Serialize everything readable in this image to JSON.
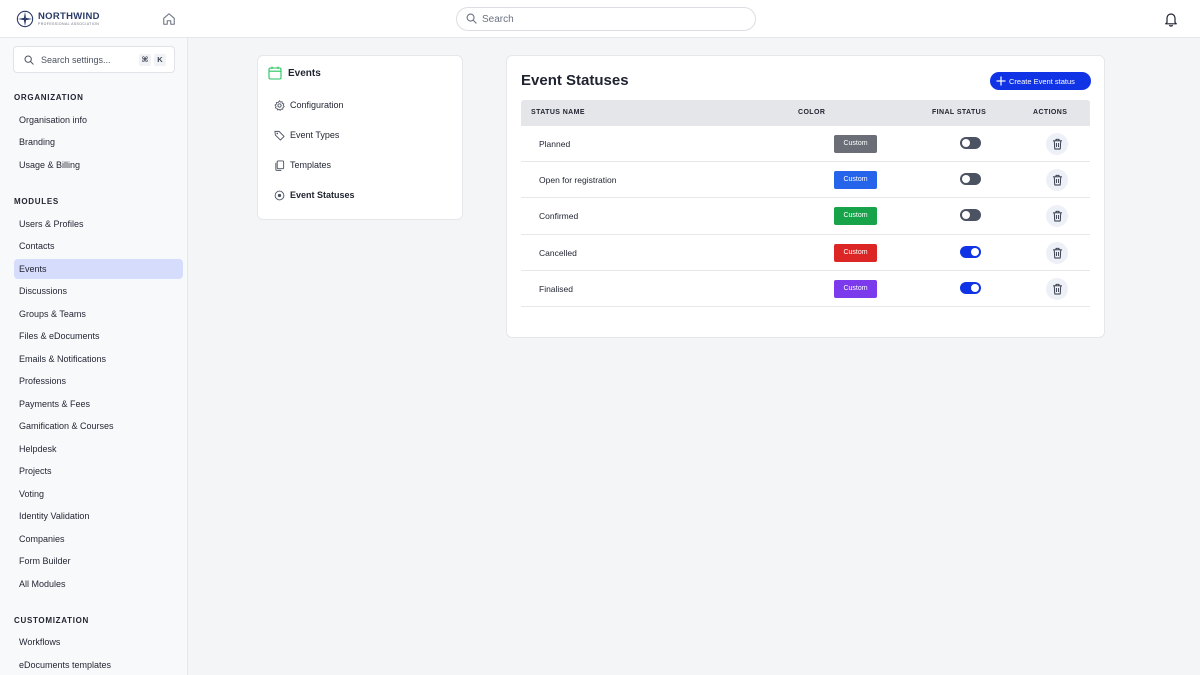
{
  "header": {
    "logo_name": "NORTHWIND",
    "logo_sub": "PROFESSIONAL ASSOCIATION",
    "search_placeholder": "Search"
  },
  "sidebar": {
    "search_placeholder": "Search settings...",
    "shortcut_mod": "⌘",
    "shortcut_key": "K",
    "sections": [
      {
        "title": "ORGANIZATION",
        "items": [
          "Organisation info",
          "Branding",
          "Usage & Billing"
        ]
      },
      {
        "title": "MODULES",
        "items": [
          "Users & Profiles",
          "Contacts",
          "Events",
          "Discussions",
          "Groups & Teams",
          "Files & eDocuments",
          "Emails & Notifications",
          "Professions",
          "Payments & Fees",
          "Gamification & Courses",
          "Helpdesk",
          "Projects",
          "Voting",
          "Identity Validation",
          "Companies",
          "Form Builder",
          "All Modules"
        ]
      },
      {
        "title": "CUSTOMIZATION",
        "items": [
          "Workflows",
          "eDocuments templates"
        ]
      }
    ],
    "active_item": "Events"
  },
  "submenu": {
    "title": "Events",
    "items": [
      "Configuration",
      "Event Types",
      "Templates",
      "Event Statuses"
    ],
    "active": "Event Statuses"
  },
  "main": {
    "title": "Event Statuses",
    "create_label": "Create Event status",
    "columns": [
      "STATUS NAME",
      "COLOR",
      "FINAL STATUS",
      "ACTIONS"
    ],
    "rows": [
      {
        "name": "Planned",
        "color_label": "Custom",
        "color": "#6b6e76",
        "final": false
      },
      {
        "name": "Open for registration",
        "color_label": "Custom",
        "color": "#2563eb",
        "final": false
      },
      {
        "name": "Confirmed",
        "color_label": "Custom",
        "color": "#16a34a",
        "final": false
      },
      {
        "name": "Cancelled",
        "color_label": "Custom",
        "color": "#dc2626",
        "final": true
      },
      {
        "name": "Finalised",
        "color_label": "Custom",
        "color": "#7c3aed",
        "final": true
      }
    ]
  },
  "colors": {
    "accent": "#1133e6",
    "active_nav_bg": "#d6dcfb",
    "calendar_icon": "#22c55e"
  }
}
